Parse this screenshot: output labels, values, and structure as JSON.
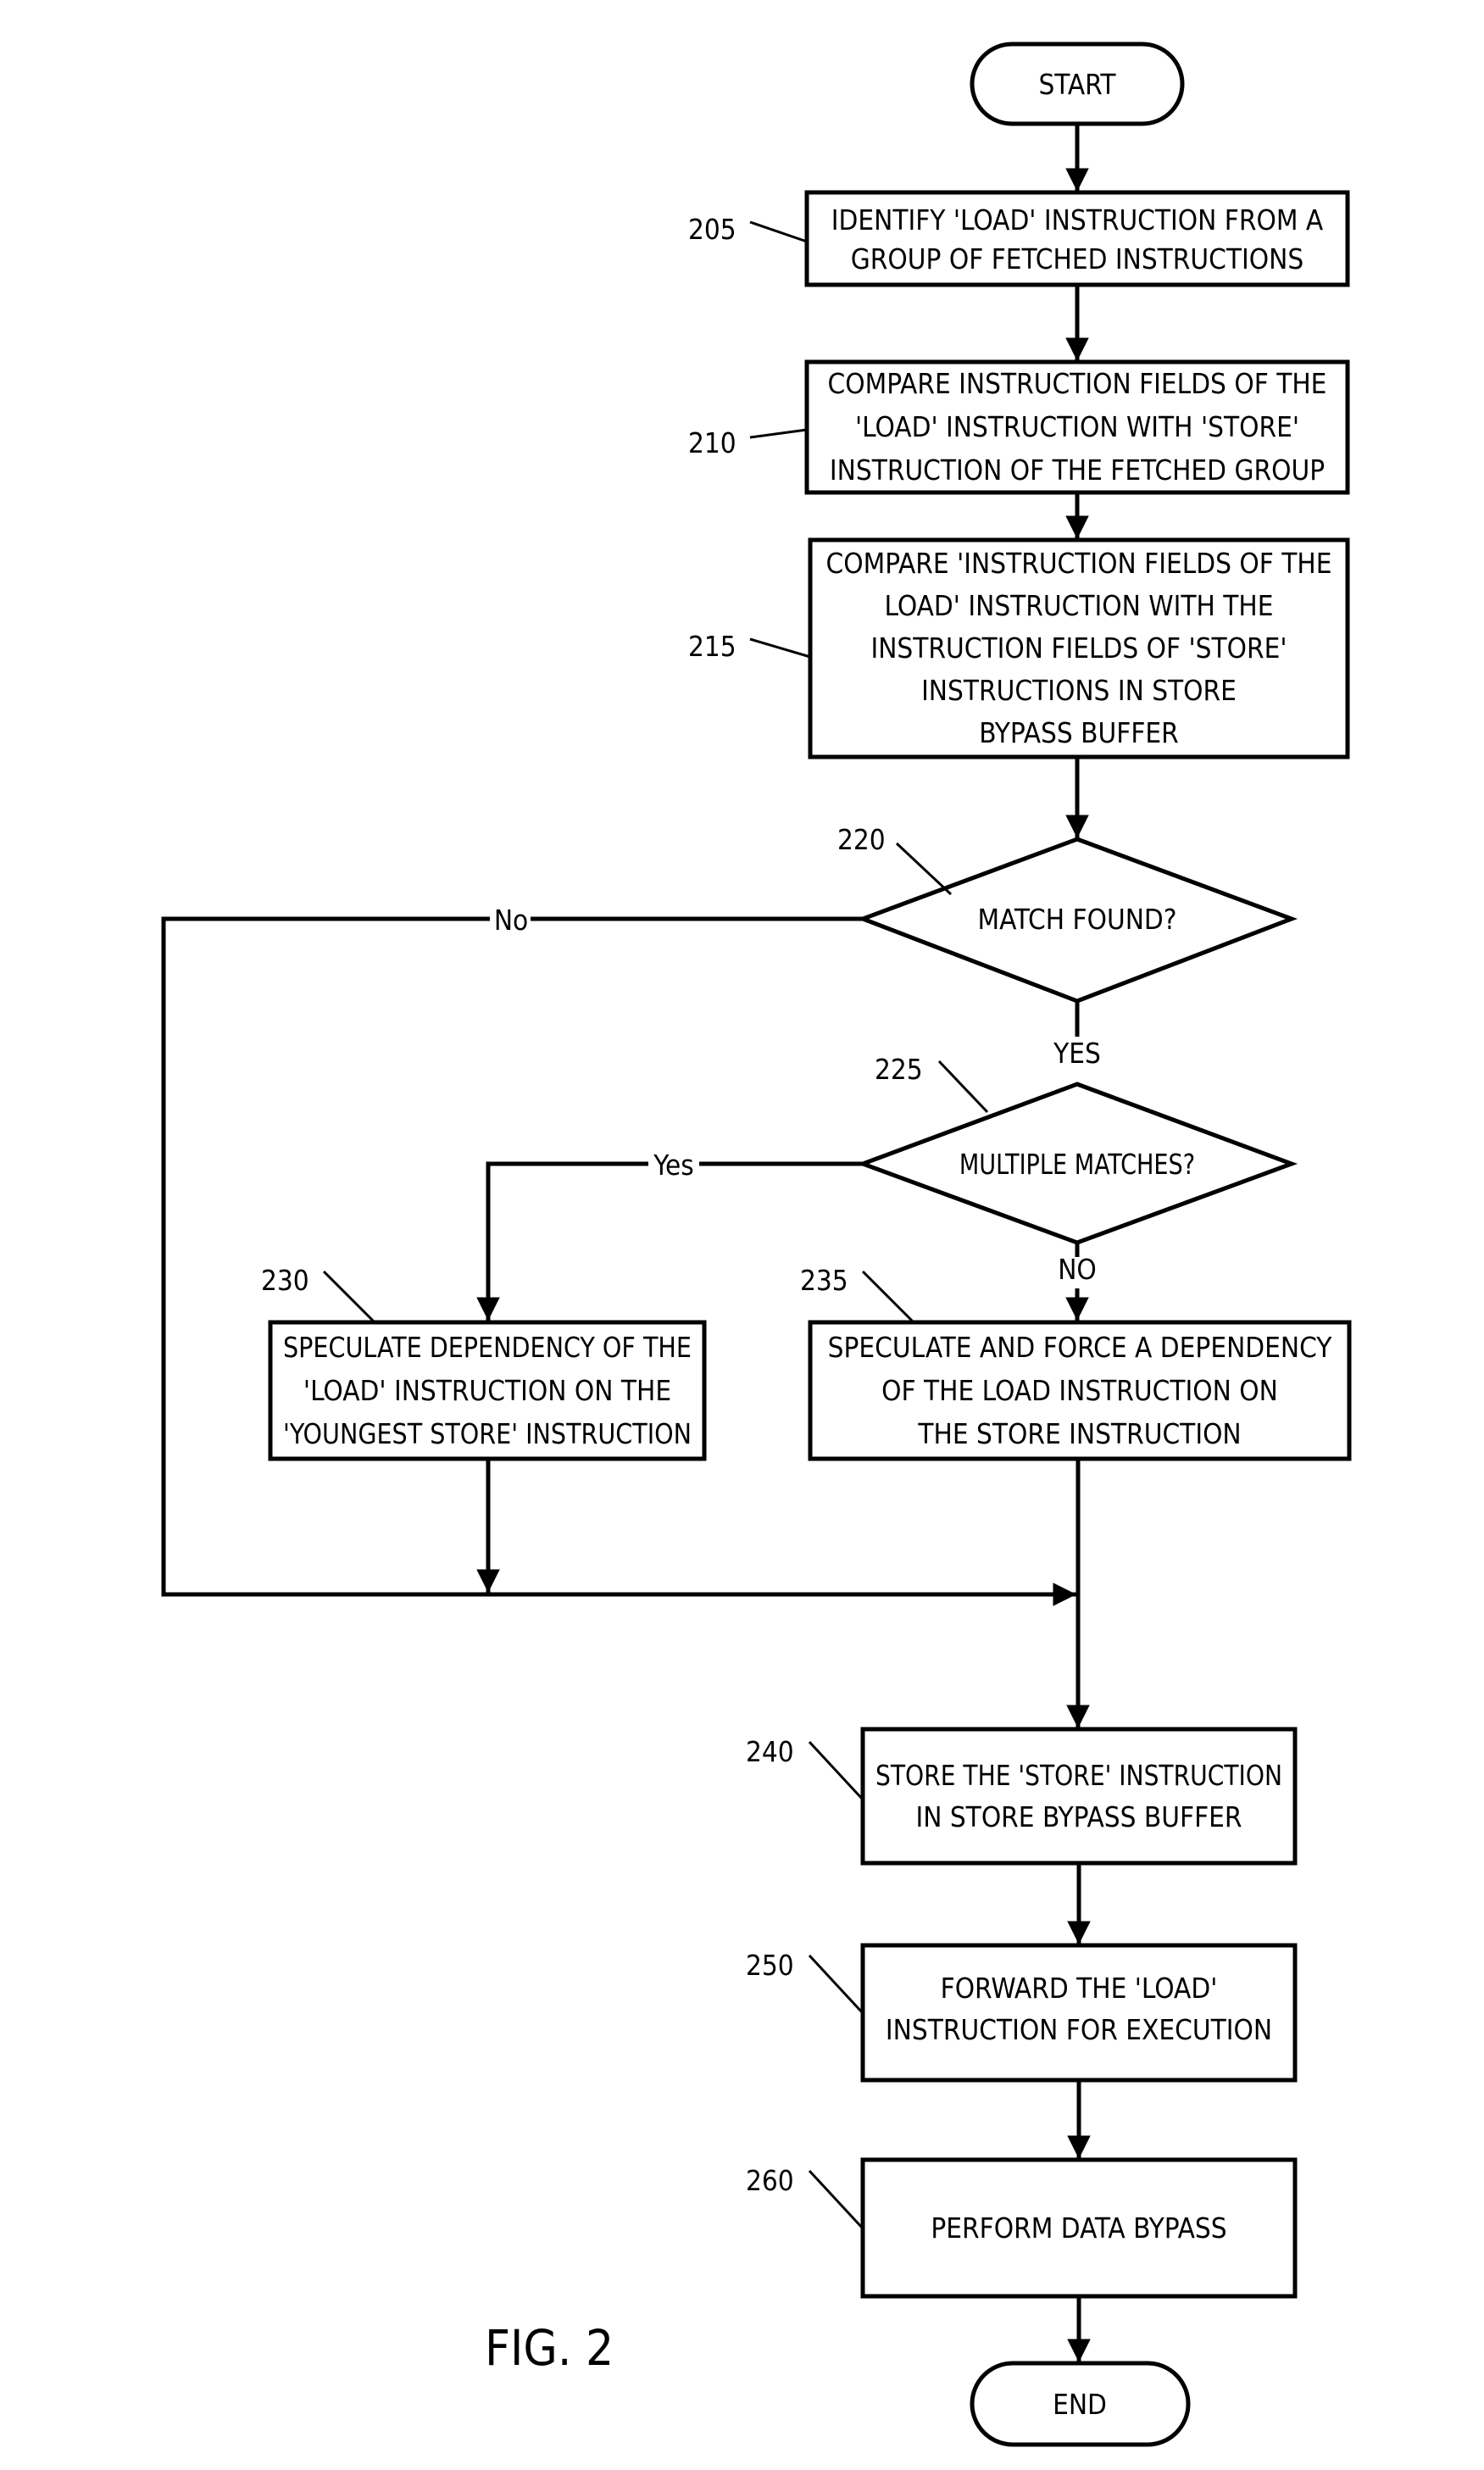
{
  "figure": {
    "caption": "FIG. 2",
    "terminals": {
      "start": "START",
      "end": "END"
    },
    "steps": {
      "s205": {
        "ref": "205",
        "lines": [
          "IDENTIFY 'LOAD' INSTRUCTION FROM A",
          "GROUP OF FETCHED INSTRUCTIONS"
        ]
      },
      "s210": {
        "ref": "210",
        "lines": [
          "COMPARE INSTRUCTION FIELDS OF THE",
          "'LOAD' INSTRUCTION WITH 'STORE'",
          "INSTRUCTION OF THE FETCHED GROUP"
        ]
      },
      "s215": {
        "ref": "215",
        "lines": [
          "COMPARE 'INSTRUCTION FIELDS OF THE",
          "LOAD' INSTRUCTION WITH THE",
          "INSTRUCTION FIELDS OF 'STORE'",
          "INSTRUCTIONS IN STORE",
          "BYPASS BUFFER"
        ]
      },
      "s220": {
        "ref": "220",
        "lines": [
          "MATCH FOUND?"
        ]
      },
      "s225": {
        "ref": "225",
        "lines": [
          "MULTIPLE MATCHES?"
        ]
      },
      "s230": {
        "ref": "230",
        "lines": [
          "SPECULATE DEPENDENCY OF THE",
          "'LOAD' INSTRUCTION ON THE",
          "'YOUNGEST STORE' INSTRUCTION"
        ]
      },
      "s235": {
        "ref": "235",
        "lines": [
          "SPECULATE AND FORCE A DEPENDENCY",
          "OF THE LOAD INSTRUCTION ON",
          "THE STORE INSTRUCTION"
        ]
      },
      "s240": {
        "ref": "240",
        "lines": [
          "STORE THE 'STORE' INSTRUCTION",
          "IN STORE BYPASS BUFFER"
        ]
      },
      "s250": {
        "ref": "250",
        "lines": [
          "FORWARD THE 'LOAD'",
          "INSTRUCTION FOR EXECUTION"
        ]
      },
      "s260": {
        "ref": "260",
        "lines": [
          "PERFORM DATA BYPASS"
        ]
      }
    },
    "edge_labels": {
      "match_no": "No",
      "match_yes": "YES",
      "multi_yes": "Yes",
      "multi_no": "NO"
    }
  }
}
